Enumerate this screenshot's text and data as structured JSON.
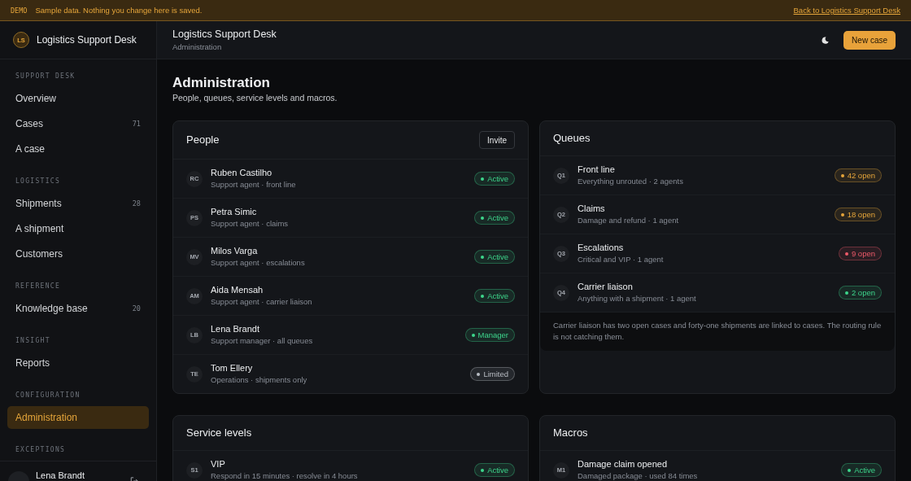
{
  "demo_banner": {
    "tag": "DEMO",
    "message": "Sample data. Nothing you change here is saved.",
    "link": "Back to Logistics Support Desk"
  },
  "sidebar": {
    "brand": {
      "initials": "LS",
      "name": "Logistics Support Desk"
    },
    "sections": [
      {
        "heading": "SUPPORT DESK",
        "items": [
          {
            "label": "Overview",
            "selected": false
          },
          {
            "label": "Cases",
            "count": "71",
            "selected": false
          },
          {
            "label": "A case",
            "selected": false
          }
        ]
      },
      {
        "heading": "LOGISTICS",
        "items": [
          {
            "label": "Shipments",
            "count": "28",
            "selected": false
          },
          {
            "label": "A shipment",
            "selected": false
          },
          {
            "label": "Customers",
            "selected": false
          }
        ]
      },
      {
        "heading": "REFERENCE",
        "items": [
          {
            "label": "Knowledge base",
            "count": "20",
            "selected": false
          }
        ]
      },
      {
        "heading": "INSIGHT",
        "items": [
          {
            "label": "Reports",
            "selected": false
          }
        ]
      },
      {
        "heading": "CONFIGURATION",
        "items": [
          {
            "label": "Administration",
            "selected": true
          }
        ]
      },
      {
        "heading": "EXCEPTIONS"
      }
    ],
    "user": {
      "name": "Lena Brandt"
    }
  },
  "header": {
    "title": "Logistics Support Desk",
    "subtitle": "Administration",
    "button": "New case"
  },
  "page": {
    "title": "Administration",
    "subtitle": "People, queues, service levels and macros."
  },
  "panels": [
    {
      "title": "People",
      "action": "Invite",
      "rows": [
        {
          "code": "RC",
          "name": "Ruben Castilho",
          "detail": "Support agent · front line",
          "badge": {
            "label": "Active",
            "color": "#3dd68c"
          }
        },
        {
          "code": "PS",
          "name": "Petra Simic",
          "detail": "Support agent · claims",
          "badge": {
            "label": "Active",
            "color": "#3dd68c"
          }
        },
        {
          "code": "MV",
          "name": "Milos Varga",
          "detail": "Support agent · escalations",
          "badge": {
            "label": "Active",
            "color": "#3dd68c"
          }
        },
        {
          "code": "AM",
          "name": "Aida Mensah",
          "detail": "Support agent · carrier liaison",
          "badge": {
            "label": "Active",
            "color": "#3dd68c"
          }
        },
        {
          "code": "LB",
          "name": "Lena Brandt",
          "detail": "Support manager · all queues",
          "badge": {
            "label": "Manager",
            "color": "#3dd68c"
          }
        },
        {
          "code": "TE",
          "name": "Tom Ellery",
          "detail": "Operations · shipments only",
          "badge": {
            "label": "Limited",
            "color": "#b9bdc4"
          }
        }
      ]
    },
    {
      "title": "Queues",
      "rows": [
        {
          "code": "Q1",
          "name": "Front line",
          "detail": "Everything unrouted · 2 agents",
          "badge": {
            "label": "42 open",
            "color": "#e5a53a"
          }
        },
        {
          "code": "Q2",
          "name": "Claims",
          "detail": "Damage and refund · 1 agent",
          "badge": {
            "label": "18 open",
            "color": "#e5a53a"
          }
        },
        {
          "code": "Q3",
          "name": "Escalations",
          "detail": "Critical and VIP · 1 agent",
          "badge": {
            "label": "9 open",
            "color": "#ef5a6a"
          }
        },
        {
          "code": "Q4",
          "name": "Carrier liaison",
          "detail": "Anything with a shipment · 1 agent",
          "badge": {
            "label": "2 open",
            "color": "#3dd68c"
          }
        }
      ],
      "note": "Carrier liaison has two open cases and forty-one shipments are linked to cases. The routing rule is not catching them."
    },
    {
      "title": "Service levels",
      "rows": [
        {
          "code": "S1",
          "name": "VIP",
          "detail": "Respond in 15 minutes · resolve in 4 hours",
          "badge": {
            "label": "Active",
            "color": "#3dd68c"
          }
        }
      ]
    },
    {
      "title": "Macros",
      "rows": [
        {
          "code": "M1",
          "name": "Damage claim opened",
          "detail": "Damaged package · used 84 times",
          "badge": {
            "label": "Active",
            "color": "#3dd68c"
          }
        }
      ]
    }
  ]
}
